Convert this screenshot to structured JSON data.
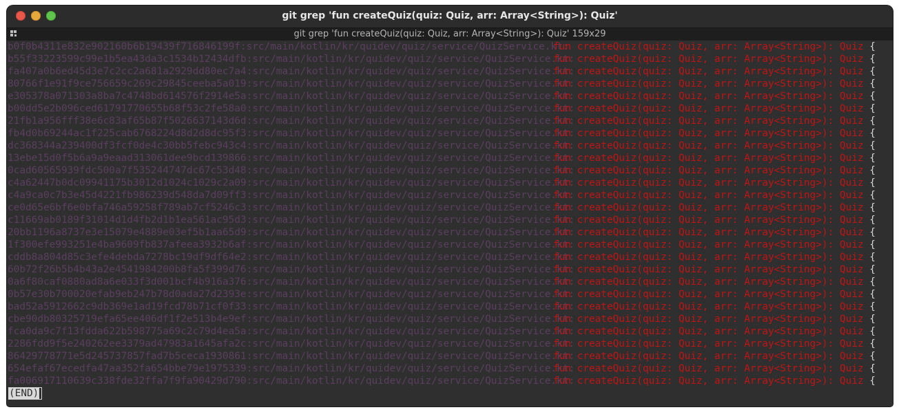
{
  "window": {
    "title": "git grep 'fun createQuiz(quiz: Quiz, arr: Array<String>): Quiz'",
    "tab_label": "git grep 'fun createQuiz(quiz: Quiz, arr: Array<String>): Quiz'  159x29"
  },
  "terminal": {
    "path": ":src/main/kotlin/kr/quidev/quiz/service/QuizService.kt:",
    "code": "fun createQuiz(quiz: Quiz, arr: Array<String>): Quiz",
    "brace": " {",
    "hashes": [
      "b0f0b4311e832e902160b6b19439f716846199f",
      "b55f33223599c99e1b5ea43da3c1534b12434dfb",
      "fa407a0b6ed45d3e7c2cc2a681a2929dd80ec7a4",
      "80766f1e91f9ce756659c269c29845ceeba5a019",
      "e305378a071303a8ba7c4748bd614576f2914e5a",
      "b00dd5e2b096ced61791770655b68f53c2fe58a0",
      "21fb1a956fff38e6c83af65b87f5026637143d6d",
      "fb4d0b69244ac1f225cab6768224d8d2d8dc95f3",
      "dc368344a239400df3fcf0de4c30bb5febc943c4",
      "13ebe15d0f5b6a9a9eaad313061dee9bcd139866",
      "0cad60565939fdc500a7f535244747dc67c53d48",
      "c4a62447b0dc09941175b3012d1024c1029c2a09",
      "c4a9ca0c7b3e45d4221fb986239d548da7d09ff3",
      "ce0d65e6bf6e0bfa746a59258f789ab7cf5246c3",
      "c11669ab0189f31014d1d4fb2d1b1ea561ac95d3",
      "20bb1196a8737e3e15079e4889e03ef5b1aa65d9",
      "1f300efe993251e4ba9609fb837afeea3932b6af",
      "cddb8a804d85c3efe4debda7278bc19df9df64e2",
      "60b72f26b5b4b43a2e4541984200b8fa5f399d76",
      "0a6f80caf0880ad8a6e033f3d001bcf4b916a376",
      "0b57e30b700020efab9eb247b78d0ada27d2393e",
      "bad52a5912662c9db369e1ad19fcd78b71cf0f33",
      "cbe90db80325719efa65ee406df1f2e513b4e9ef",
      "fca0da9c7f13fdda622b598775a69c2c79d4ea5a",
      "2286fdd9f5e240262ee3379ad47983a1645afa2c",
      "86429778771e5d245737857fad7b5ceca1930861",
      "654efaf67ecedfa47aa352fa654bbe79e1975339",
      "fa006917110639c338fde32ffa7f9fa90429d790"
    ],
    "end_marker": "(END)"
  },
  "colors": {
    "hash_path": "#5a3f5e",
    "match": "#c11414",
    "background": "#2f2f2f"
  }
}
